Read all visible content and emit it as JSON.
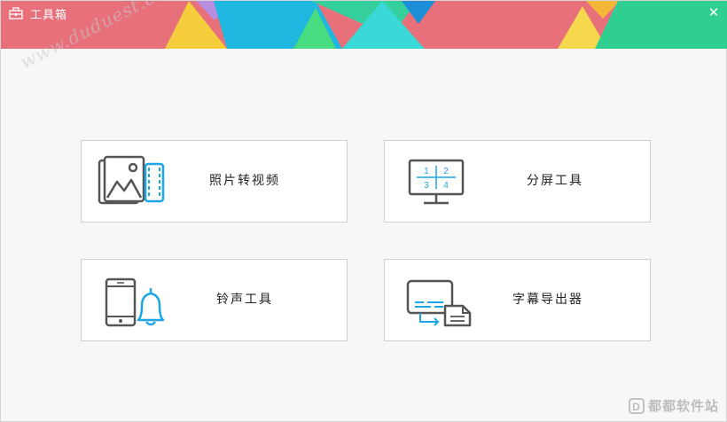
{
  "window": {
    "title": "工具箱",
    "close_glyph": "✕",
    "watermark": "www.duduest.com",
    "colors": {
      "banner_base": "#e8707a",
      "accent_blue": "#1ca6e6",
      "icon_gray": "#555555"
    }
  },
  "cards": [
    {
      "label": "照片转视频",
      "icon": "photo-to-video-icon"
    },
    {
      "label": "分屏工具",
      "icon": "split-screen-icon",
      "icon_digits": [
        "1",
        "2",
        "3",
        "4"
      ]
    },
    {
      "label": "铃声工具",
      "icon": "ringtone-icon"
    },
    {
      "label": "字幕导出器",
      "icon": "subtitle-export-icon"
    }
  ],
  "brand": {
    "text": "都都软件站",
    "logo": "D"
  }
}
